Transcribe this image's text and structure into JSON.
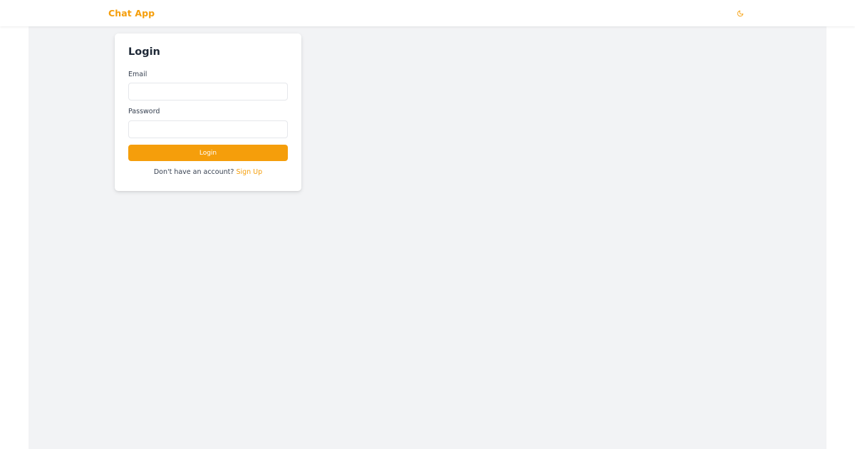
{
  "header": {
    "brand": "Chat App",
    "theme_icon": "moon-icon",
    "accent_color": "#f59e0b"
  },
  "login_form": {
    "title": "Login",
    "email_label": "Email",
    "email_value": "",
    "email_placeholder": "",
    "password_label": "Password",
    "password_value": "",
    "password_placeholder": "",
    "submit_label": "Login",
    "signup_prompt": "Don't have an account?",
    "signup_link": "Sign Up"
  },
  "colors": {
    "background": "#f2f3f5",
    "card": "#ffffff",
    "accent": "#f59e0b",
    "text": "#1f2937"
  }
}
